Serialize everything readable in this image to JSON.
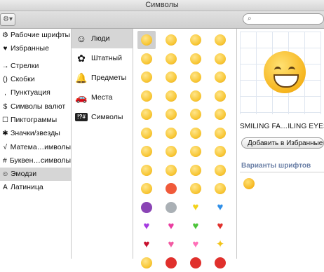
{
  "window": {
    "title": "Символы"
  },
  "toolbar": {
    "gear_icon": "gear-icon",
    "search_value": ""
  },
  "categories": [
    {
      "label": "Рабочие шрифты",
      "icon": "⚙"
    },
    {
      "label": "Избранные",
      "icon": "♥"
    },
    {
      "label": "Стрелки",
      "icon": "→"
    },
    {
      "label": "Скобки",
      "icon": "()"
    },
    {
      "label": "Пунктуация",
      "icon": ","
    },
    {
      "label": "Символы валют",
      "icon": "$"
    },
    {
      "label": "Пиктограммы",
      "icon": "☐"
    },
    {
      "label": "Значки/звезды",
      "icon": "✱"
    },
    {
      "label": "Матема…имволы",
      "icon": "√"
    },
    {
      "label": "Буквен…символы",
      "icon": "#"
    },
    {
      "label": "Эмодзи",
      "icon": "☺",
      "selected": true
    },
    {
      "label": "Латиница",
      "icon": "A"
    }
  ],
  "subcategories": [
    {
      "label": "Люди",
      "icon": "☺",
      "selected": true
    },
    {
      "label": "Штатный",
      "icon": "✿"
    },
    {
      "label": "Предметы",
      "icon": "🔔"
    },
    {
      "label": "Места",
      "icon": "🚗"
    },
    {
      "label": "Символы",
      "icon": "!?#"
    }
  ],
  "emoji_grid": [
    [
      "#f7c531",
      "#f7c531",
      "#f7c531",
      "#f7c531"
    ],
    [
      "#f7c531",
      "#f7c531",
      "#f7c531",
      "#f7c531"
    ],
    [
      "#f7c531",
      "#f7c531",
      "#f7c531",
      "#f7c531"
    ],
    [
      "#f7c531",
      "#f7c531",
      "#f7c531",
      "#f7c531"
    ],
    [
      "#f7c531",
      "#f7c531",
      "#f7c531",
      "#f7c531"
    ],
    [
      "#f7c531",
      "#f7c531",
      "#f7c531",
      "#f7c531"
    ],
    [
      "#f7c531",
      "#f7c531",
      "#f7c531",
      "#f7c531"
    ],
    [
      "#f7c531",
      "#f7c531",
      "#f7c531",
      "#f7c531"
    ],
    [
      "#f7c531",
      "#f05a3a",
      "#f7c531",
      "#f7c531"
    ],
    [
      "#8a44b5",
      "#aab0b5",
      "heart:#f3d21a",
      "heart:#2f8fe8"
    ],
    [
      "heart:#a53be0",
      "heart:#ea3ca0",
      "heart:#4cc43a",
      "heart:#e0302c"
    ],
    [
      "heart:#c8102e",
      "heart:#f25aa2",
      "heart:#ff6fb8",
      "sparkle:#f2c318"
    ],
    [
      "#f7c531",
      "#e0302c",
      "#e0302c",
      "#e0302c"
    ]
  ],
  "details": {
    "char_name": "SMILING FA…ILING EYES",
    "fav_button": "Добавить в Избранные",
    "font_variants_label": "Варианты шрифтов",
    "preview_icon": "smiling-face-with-open-mouth-and-smiling-eyes-icon"
  }
}
